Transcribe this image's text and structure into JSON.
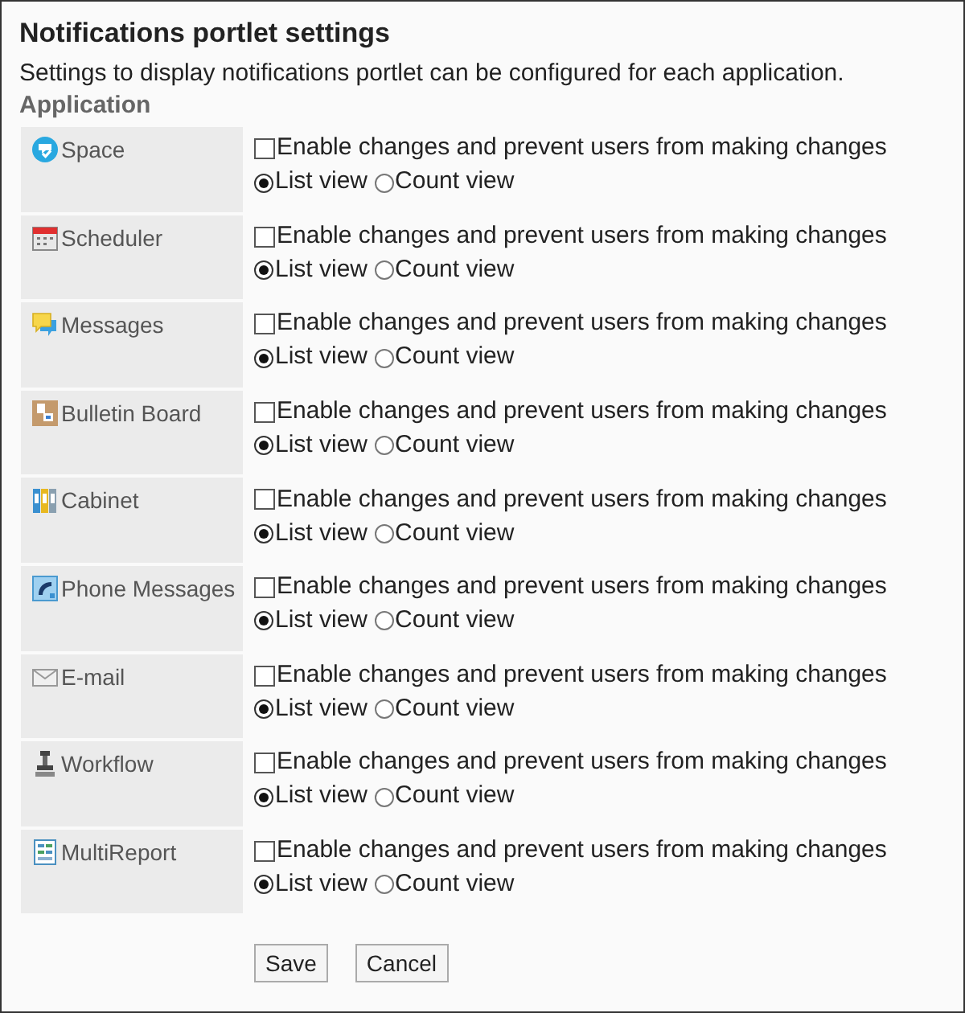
{
  "title": "Notifications portlet settings",
  "description": "Settings to display notifications portlet can be configured for each application.",
  "section_label": "Application",
  "applications": [
    {
      "kind": "space",
      "name": "Space",
      "option_label": "Enable changes and prevent users from making changes",
      "checked": false,
      "views": [
        {
          "label": "List view",
          "selected": true
        },
        {
          "label": "Count view",
          "selected": false
        }
      ]
    },
    {
      "kind": "scheduler",
      "name": "Scheduler",
      "option_label": "Enable changes and prevent users from making changes",
      "checked": false,
      "views": [
        {
          "label": "List view",
          "selected": true
        },
        {
          "label": "Count view",
          "selected": false
        }
      ]
    },
    {
      "kind": "messages",
      "name": "Messages",
      "option_label": "Enable changes and prevent users from making changes",
      "checked": false,
      "views": [
        {
          "label": "List view",
          "selected": true
        },
        {
          "label": "Count view",
          "selected": false
        }
      ]
    },
    {
      "kind": "board",
      "name": "Bulletin Board",
      "option_label": "Enable changes and prevent users from making changes",
      "checked": false,
      "views": [
        {
          "label": "List view",
          "selected": true
        },
        {
          "label": "Count view",
          "selected": false
        }
      ]
    },
    {
      "kind": "cabinet",
      "name": "Cabinet",
      "option_label": "Enable changes and prevent users from making changes",
      "checked": false,
      "views": [
        {
          "label": "List view",
          "selected": true
        },
        {
          "label": "Count view",
          "selected": false
        }
      ]
    },
    {
      "kind": "phone",
      "name": "Phone Messages",
      "option_label": "Enable changes and prevent users from making changes",
      "checked": false,
      "views": [
        {
          "label": "List view",
          "selected": true
        },
        {
          "label": "Count view",
          "selected": false
        }
      ]
    },
    {
      "kind": "email",
      "name": "E-mail",
      "option_label": "Enable changes and prevent users from making changes",
      "checked": false,
      "views": [
        {
          "label": "List view",
          "selected": true
        },
        {
          "label": "Count view",
          "selected": false
        }
      ]
    },
    {
      "kind": "workflow",
      "name": "Workflow",
      "option_label": "Enable changes and prevent users from making changes",
      "checked": false,
      "views": [
        {
          "label": "List view",
          "selected": true
        },
        {
          "label": "Count view",
          "selected": false
        }
      ]
    },
    {
      "kind": "report",
      "name": "MultiReport",
      "option_label": "Enable changes and prevent users from making changes",
      "checked": false,
      "views": [
        {
          "label": "List view",
          "selected": true
        },
        {
          "label": "Count view",
          "selected": false
        }
      ]
    }
  ],
  "buttons": [
    "Save",
    "Cancel"
  ]
}
